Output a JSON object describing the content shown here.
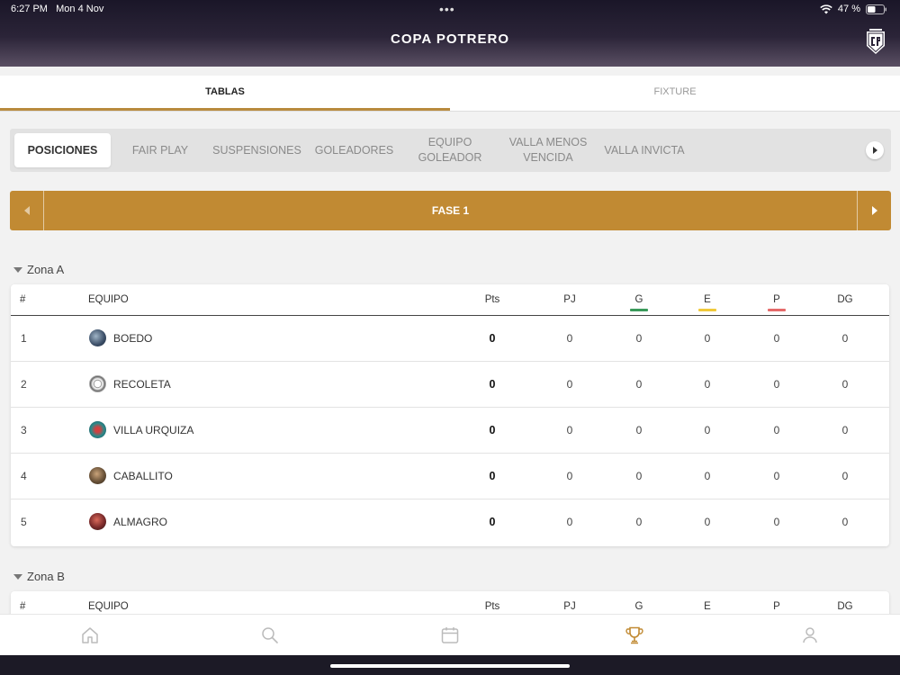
{
  "status": {
    "time": "6:27 PM",
    "date": "Mon 4 Nov",
    "battery": "47 %"
  },
  "app": {
    "title": "COPA POTRERO"
  },
  "tabs": [
    {
      "label": "TABLAS"
    },
    {
      "label": "FIXTURE"
    }
  ],
  "subtabs": [
    {
      "label": "POSICIONES"
    },
    {
      "label": "FAIR PLAY"
    },
    {
      "label": "SUSPENSIONES"
    },
    {
      "label": "GOLEADORES"
    },
    {
      "label": "EQUIPO GOLEADOR"
    },
    {
      "label": "VALLA MENOS VENCIDA"
    },
    {
      "label": "VALLA INVICTA"
    }
  ],
  "phase": {
    "label": "FASE 1"
  },
  "columns": {
    "rank": "#",
    "team": "EQUIPO",
    "pts": "Pts",
    "pj": "PJ",
    "g": "G",
    "e": "E",
    "p": "P",
    "dg": "DG"
  },
  "colors": {
    "accent": "#c18a33",
    "win": "#3a9a5b",
    "draw": "#f0c93a",
    "loss": "#e56a6a"
  },
  "zones": [
    {
      "name": "Zona A",
      "rows": [
        {
          "rank": "1",
          "team": "BOEDO",
          "pts": "0",
          "pj": "0",
          "g": "0",
          "e": "0",
          "p": "0",
          "dg": "0"
        },
        {
          "rank": "2",
          "team": "RECOLETA",
          "pts": "0",
          "pj": "0",
          "g": "0",
          "e": "0",
          "p": "0",
          "dg": "0"
        },
        {
          "rank": "3",
          "team": "VILLA URQUIZA",
          "pts": "0",
          "pj": "0",
          "g": "0",
          "e": "0",
          "p": "0",
          "dg": "0"
        },
        {
          "rank": "4",
          "team": "CABALLITO",
          "pts": "0",
          "pj": "0",
          "g": "0",
          "e": "0",
          "p": "0",
          "dg": "0"
        },
        {
          "rank": "5",
          "team": "ALMAGRO",
          "pts": "0",
          "pj": "0",
          "g": "0",
          "e": "0",
          "p": "0",
          "dg": "0"
        }
      ]
    },
    {
      "name": "Zona B",
      "rows": []
    }
  ],
  "nav": [
    {
      "icon": "home-icon"
    },
    {
      "icon": "search-icon"
    },
    {
      "icon": "calendar-icon"
    },
    {
      "icon": "trophy-icon"
    },
    {
      "icon": "profile-icon"
    }
  ]
}
